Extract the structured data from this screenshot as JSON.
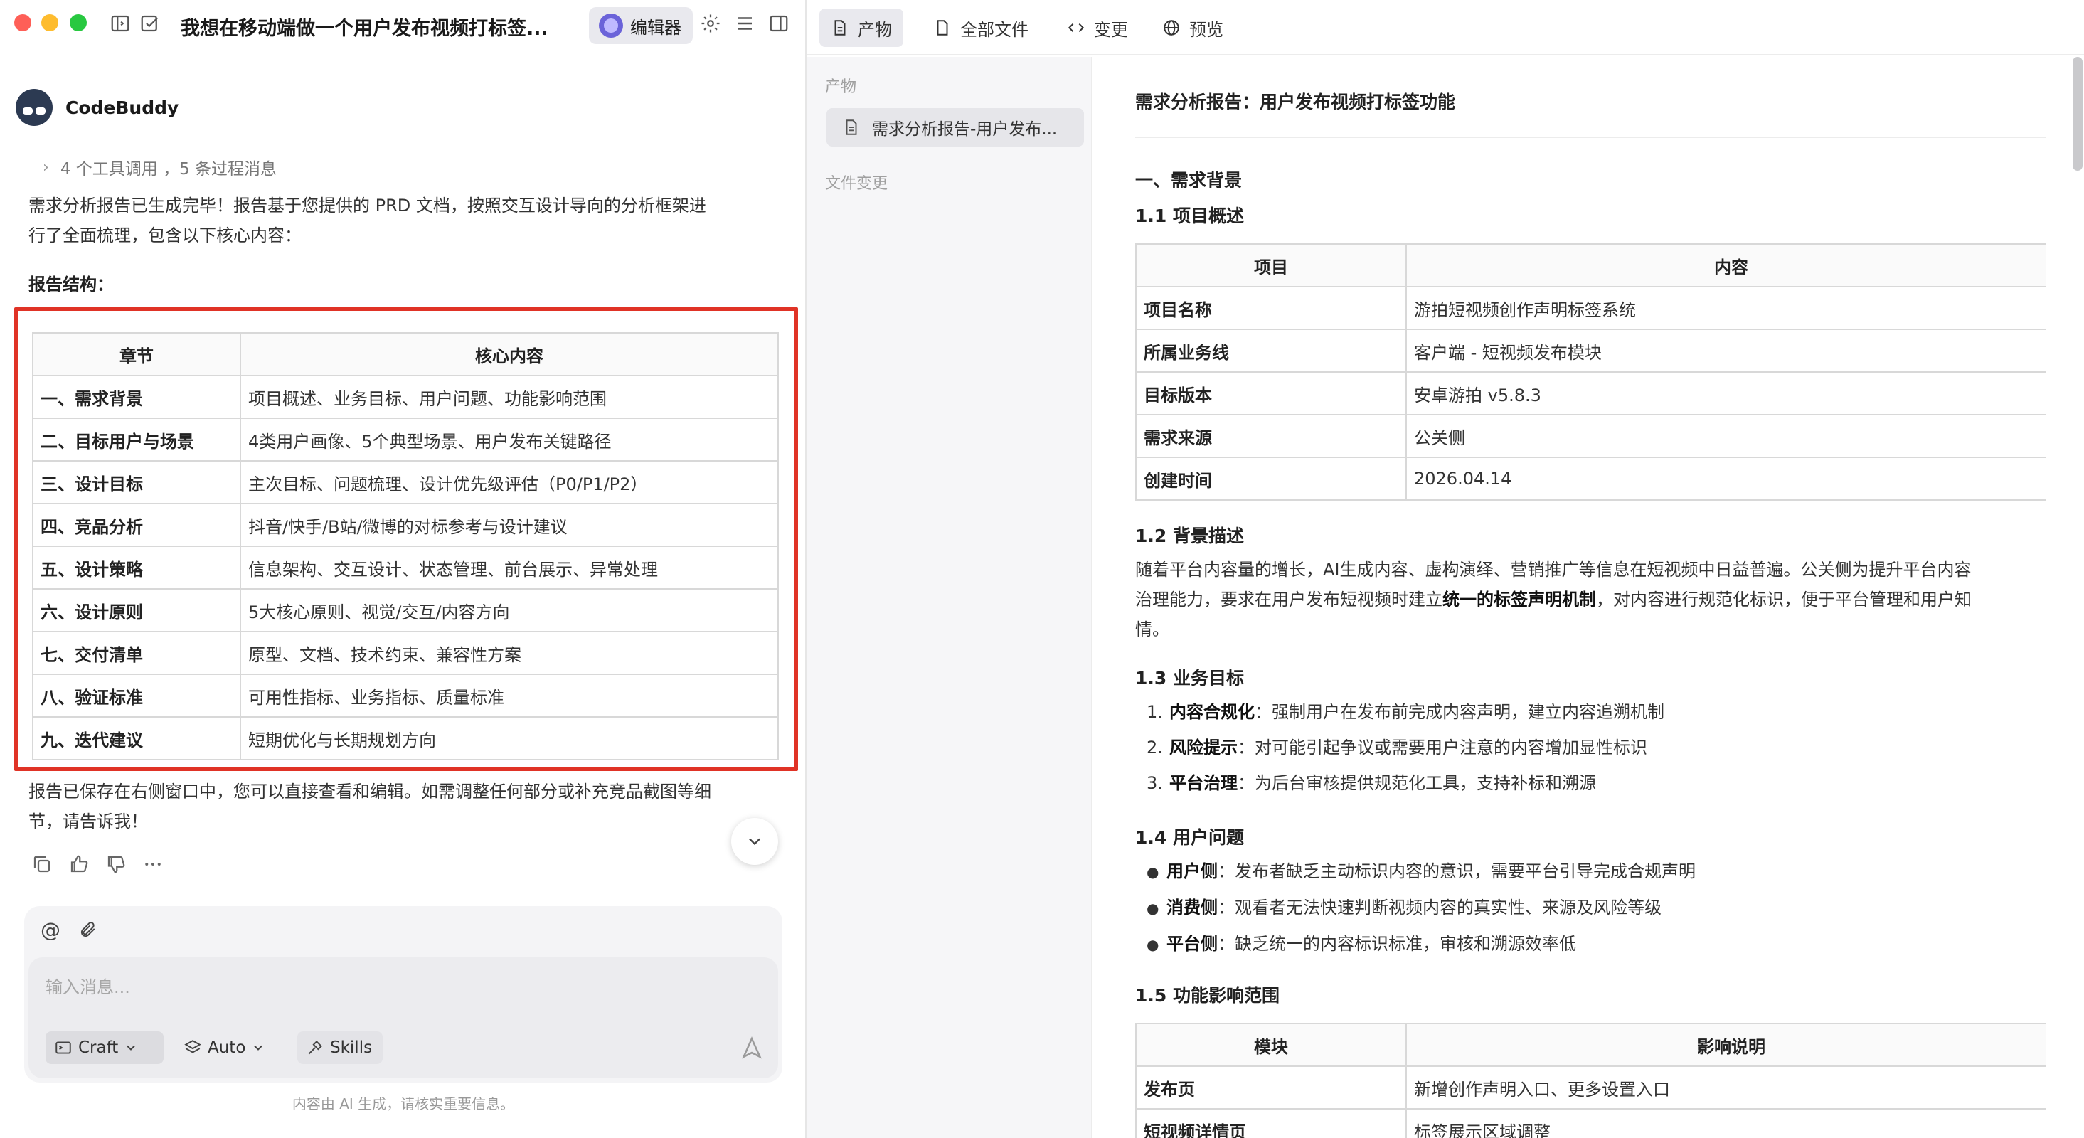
{
  "window": {
    "title": "我想在移动端做一个用户发布视频打标签...",
    "editor_label": "编辑器"
  },
  "chat": {
    "agent_name": "CodeBuddy",
    "tool_calls": "4 个工具调用 ，5 条过程消息",
    "intro_line1": "需求分析报告已生成完毕！报告基于您提供的 PRD 文档，按照交互设计导向的分析框架进",
    "intro_line2": "行了全面梳理，包含以下核心内容：",
    "structure_label": "报告结构：",
    "table": {
      "headers": [
        "章节",
        "核心内容"
      ],
      "rows": [
        [
          "一、需求背景",
          "项目概述、业务目标、用户问题、功能影响范围"
        ],
        [
          "二、目标用户与场景",
          "4类用户画像、5个典型场景、用户发布关键路径"
        ],
        [
          "三、设计目标",
          "主次目标、问题梳理、设计优先级评估（P0/P1/P2）"
        ],
        [
          "四、竞品分析",
          "抖音/快手/B站/微博的对标参考与设计建议"
        ],
        [
          "五、设计策略",
          "信息架构、交互设计、状态管理、前台展示、异常处理"
        ],
        [
          "六、设计原则",
          "5大核心原则、视觉/交互/内容方向"
        ],
        [
          "七、交付清单",
          "原型、文档、技术约束、兼容性方案"
        ],
        [
          "八、验证标准",
          "可用性指标、业务指标、质量标准"
        ],
        [
          "九、迭代建议",
          "短期优化与长期规划方向"
        ]
      ]
    },
    "outro_line1": "报告已保存在右侧窗口中，您可以直接查看和编辑。如需调整任何部分或补充竞品截图等细",
    "outro_line2": "节，请告诉我！",
    "composer": {
      "placeholder": "输入消息...",
      "value": "",
      "craft_label": "Craft",
      "auto_label": "Auto",
      "skills_label": "Skills"
    },
    "disclaimer": "内容由 AI 生成，请核实重要信息。"
  },
  "right_tabs": [
    {
      "label": "产物",
      "icon": "document-icon",
      "active": true
    },
    {
      "label": "全部文件",
      "icon": "file-icon",
      "active": false
    },
    {
      "label": "变更",
      "icon": "code-icon",
      "active": false
    },
    {
      "label": "预览",
      "icon": "globe-icon",
      "active": false
    }
  ],
  "sidebar": {
    "artifacts_label": "产物",
    "file_name": "需求分析报告-用户发布...",
    "changes_label": "文件变更"
  },
  "doc": {
    "title": "需求分析报告：用户发布视频打标签功能",
    "sec1": "一、需求背景",
    "sub11": "1.1 项目概述",
    "overview_table": {
      "headers": [
        "项目",
        "内容"
      ],
      "rows": [
        [
          "项目名称",
          "游拍短视频创作声明标签系统"
        ],
        [
          "所属业务线",
          "客户端 - 短视频发布模块"
        ],
        [
          "目标版本",
          "安卓游拍 v5.8.3"
        ],
        [
          "需求来源",
          "公关侧"
        ],
        [
          "创建时间",
          "2026.04.14"
        ]
      ]
    },
    "sub12": "1.2 背景描述",
    "bg_line1": "随着平台内容量的增长，AI生成内容、虚构演绎、营销推广等信息在短视频中日益普遍。公关侧为提升平台内容",
    "bg_line2a": "治理能力，要求在用户发布短视频时建立",
    "bg_line2b": "统一的标签声明机制",
    "bg_line2c": "，对内容进行规范化标识，便于平台管理和用户知",
    "bg_line3": "情。",
    "sub13": "1.3 业务目标",
    "goals": [
      {
        "n": "1.",
        "b": "内容合规化",
        "t": "：强制用户在发布前完成内容声明，建立内容追溯机制"
      },
      {
        "n": "2.",
        "b": "风险提示",
        "t": "：对可能引起争议或需要用户注意的内容增加显性标识"
      },
      {
        "n": "3.",
        "b": "平台治理",
        "t": "：为后台审核提供规范化工具，支持补标和溯源"
      }
    ],
    "sub14": "1.4 用户问题",
    "problems": [
      {
        "b": "用户侧",
        "t": "：发布者缺乏主动标识内容的意识，需要平台引导完成合规声明"
      },
      {
        "b": "消费侧",
        "t": "：观看者无法快速判断视频内容的真实性、来源及风险等级"
      },
      {
        "b": "平台侧",
        "t": "：缺乏统一的内容标识标准，审核和溯源效率低"
      }
    ],
    "sub15": "1.5 功能影响范围",
    "impact_table": {
      "headers": [
        "模块",
        "影响说明"
      ],
      "rows": [
        [
          "发布页",
          "新增创作声明入口、更多设置入口"
        ],
        [
          "短视频详情页",
          "标签展示区域调整"
        ]
      ]
    }
  }
}
